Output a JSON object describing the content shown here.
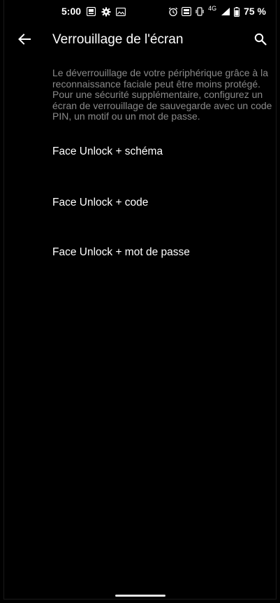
{
  "status_bar": {
    "time": "5:00",
    "network": "4G",
    "battery": "75 %"
  },
  "header": {
    "title": "Verrouillage de l'écran",
    "back_icon": "arrow-left-icon",
    "search_icon": "search-icon"
  },
  "description": "Le déverrouillage de votre périphérique grâce à la reconnaissance faciale peut être moins protégé. Pour une sécurité supplémentaire, configurez un écran de verrouillage de sauvegarde avec un code PIN, un motif ou un mot de passe.",
  "options": [
    {
      "label": "Face Unlock + schéma"
    },
    {
      "label": "Face Unlock + code"
    },
    {
      "label": "Face Unlock + mot de passe"
    }
  ],
  "colors": {
    "background": "#000000",
    "text_primary": "#ffffff",
    "text_secondary": "#8a8a8a"
  }
}
